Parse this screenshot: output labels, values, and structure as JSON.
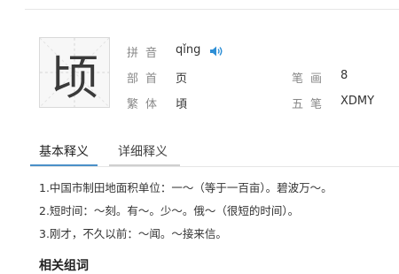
{
  "character": "顷",
  "info": {
    "pinyin_label": "拼音",
    "pinyin": "qǐng",
    "radical_label": "部首",
    "radical": "页",
    "strokes_label": "笔画",
    "strokes": "8",
    "traditional_label": "繁体",
    "traditional": "頃",
    "wubi_label": "五笔",
    "wubi": "XDMY"
  },
  "tabs": [
    {
      "label": "基本释义",
      "active": true
    },
    {
      "label": "详细释义",
      "active": false
    }
  ],
  "definitions": [
    "1.中国市制田地面积单位：一～（等于一百亩）。碧波万～。",
    "2.短时间：～刻。有～。少～。俄～（很短的时间）。",
    "3.刚才，不久以前：～闻。～接来信。"
  ],
  "related_heading": "相关组词",
  "colors": {
    "accent": "#4a90c8",
    "speaker": "#2e8fd6"
  },
  "icons": {
    "speaker": "speaker-icon"
  }
}
